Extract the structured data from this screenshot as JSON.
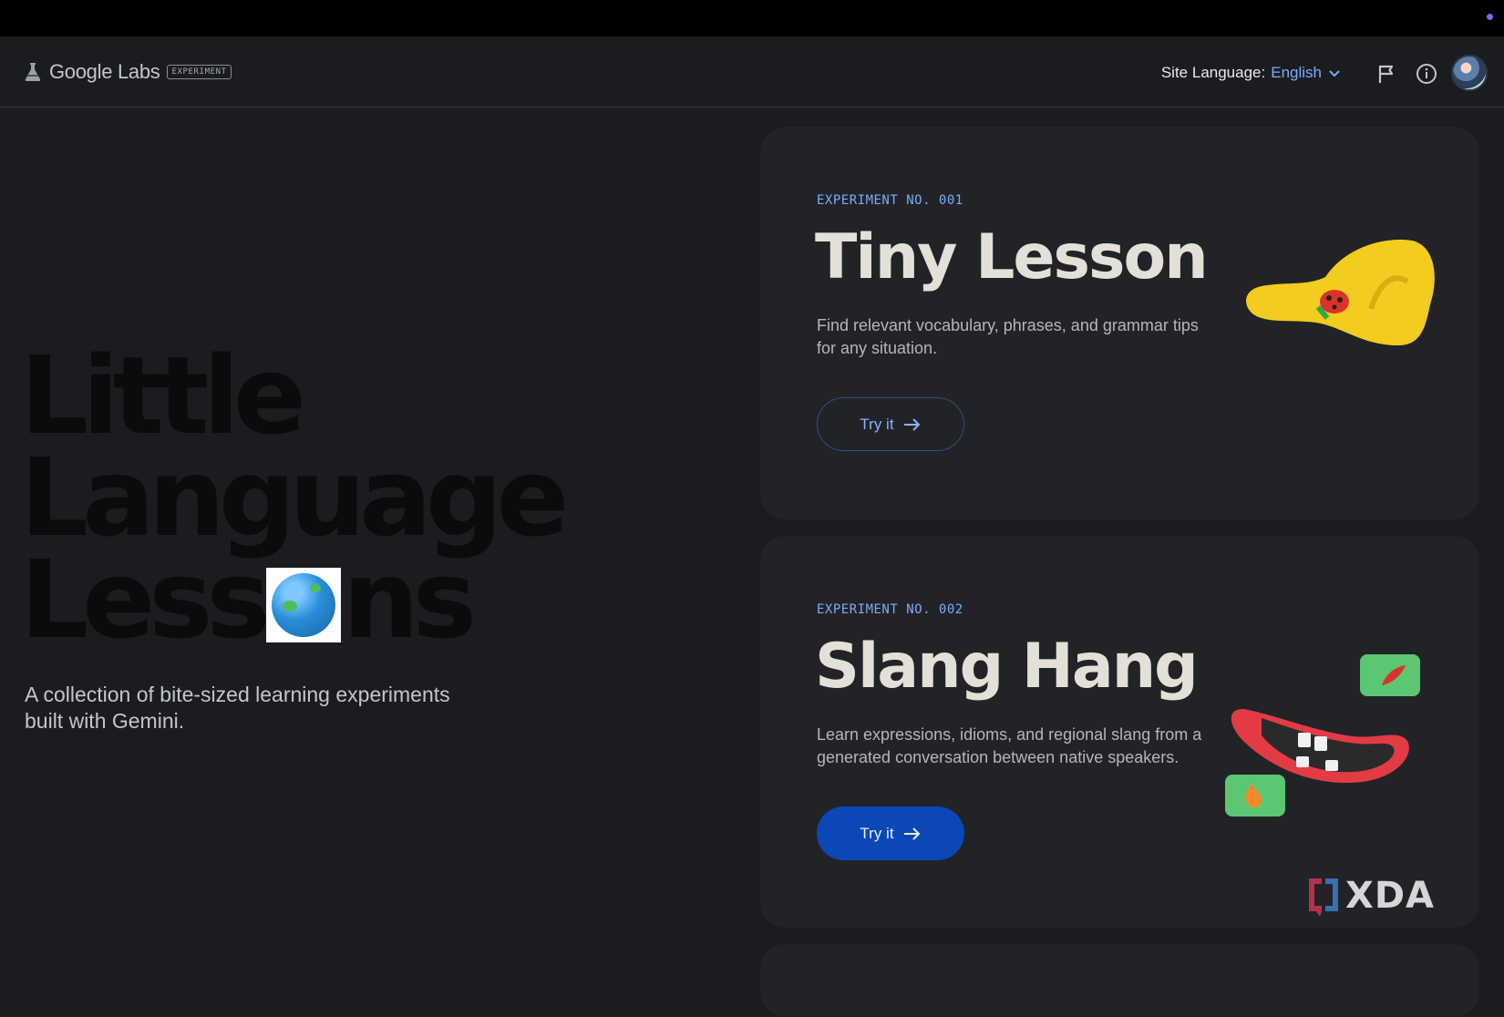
{
  "header": {
    "brand_name": "Google Labs",
    "brand_badge": "EXPERIMENT",
    "language_label": "Site Language:",
    "language_value": "English"
  },
  "hero": {
    "title_lines": [
      "Little",
      "Language",
      "Less",
      "ns"
    ],
    "subtitle": "A collection of bite-sized learning experiments built with Gemini."
  },
  "cards": [
    {
      "experiment_no": "EXPERIMENT NO. 001",
      "title": "Tiny Lesson",
      "description": "Find relevant vocabulary, phrases, and grammar tips for any situation.",
      "button_label": "Try it"
    },
    {
      "experiment_no": "EXPERIMENT NO. 002",
      "title": "Slang Hang",
      "description": "Learn expressions, idioms, and regional slang from a generated conversation between native speakers.",
      "button_label": "Try it"
    }
  ],
  "watermark": "XDA",
  "icons": [
    "flask-icon",
    "chevron-down-icon",
    "flag-icon",
    "info-icon",
    "avatar",
    "globe-icon",
    "arrow-right-icon"
  ],
  "colors": {
    "background": "#1b1c1f",
    "card": "#222327",
    "accent_blue": "#7cacf8",
    "button_filled": "#0b47b5"
  }
}
